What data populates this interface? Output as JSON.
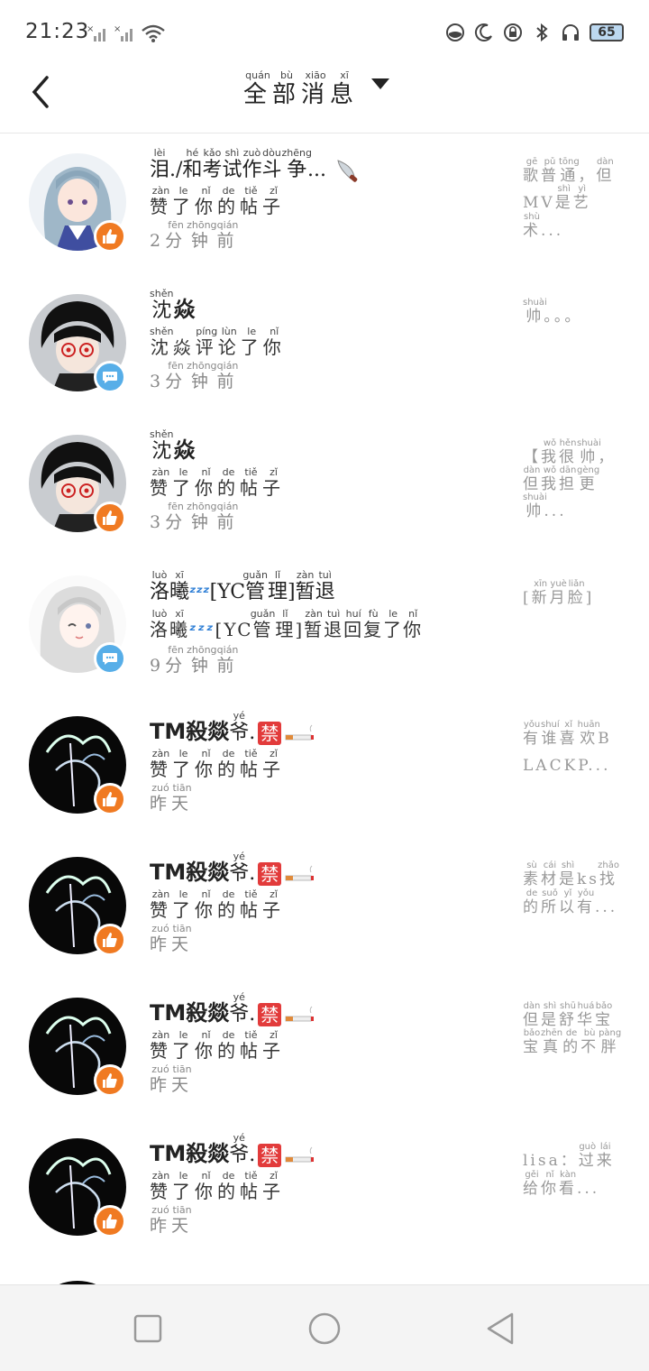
{
  "status_bar": {
    "time": "21:23",
    "battery": "65",
    "icons": [
      "signal-x-icon",
      "signal-x-icon",
      "wifi-icon",
      "data-saver-icon",
      "moon-icon",
      "lock-rotation-icon",
      "bluetooth-icon",
      "headphones-icon",
      "battery-icon"
    ]
  },
  "header": {
    "title_chars": [
      {
        "c": "全",
        "p": "quán"
      },
      {
        "c": "部",
        "p": "bù"
      },
      {
        "c": "消",
        "p": "xiāo"
      },
      {
        "c": "息",
        "p": "xī"
      }
    ]
  },
  "messages": [
    {
      "avatar": "girl-blue-hair",
      "badge": "like",
      "name_prefix": "泪./和考试作斗争...",
      "name_pinyin": "lèi    hé  kǎo  shì  zuò dòu zhēng",
      "action": "赞了你的帖子",
      "action_pinyin": "zàn  le   nǐ   de  tiě  zǐ",
      "time": "2分钟前",
      "time_pinyin": "fēn zhōng qián",
      "preview": "歌普通，但MV是艺术...",
      "preview_pinyin": "gē pǔ tōng dàn shì yì shù"
    },
    {
      "avatar": "boy-glasses",
      "badge": "comment",
      "name_prefix": "沈",
      "name_bold": "焱",
      "name_pinyin": "shěn",
      "action": "沈焱评论了你",
      "action_pinyin": "shěn   píng lùn  le   nǐ",
      "time": "3分钟前",
      "time_pinyin": "fēn zhōng qián",
      "preview": "帅。。。",
      "preview_pinyin": "shuài"
    },
    {
      "avatar": "boy-glasses",
      "badge": "like",
      "name_prefix": "沈",
      "name_bold": "焱",
      "name_pinyin": "shěn",
      "action": "赞了你的帖子",
      "action_pinyin": "zàn  le   nǐ   de  tiě  zǐ",
      "time": "3分钟前",
      "time_pinyin": "fēn zhōng qián",
      "preview": "【我很帅，但我担更帅...",
      "preview_pinyin": "wǒ hěn shuài dàn wǒ dān gèng shuài"
    },
    {
      "avatar": "girl-white-hair",
      "badge": "comment",
      "name_prefix": "洛曦",
      "name_suffix": "[YC管理]暂退",
      "name_pinyin": "luò  xī",
      "action_prefix": "洛曦",
      "action": "[YC管理]暂退回复了你",
      "action_pinyin": "luò  xī",
      "time": "9分钟前",
      "time_pinyin": "fēn zhōng qián",
      "preview": "[新月脸]",
      "preview_pinyin": "xīn yuè liǎn"
    },
    {
      "avatar": "dark-art",
      "badge": "like",
      "name_prefix": "TM殺燚",
      "name_suffix": "爷.",
      "ban": "禁",
      "name_pinyin": "yé",
      "action": "赞了你的帖子",
      "action_pinyin": "zàn  le   nǐ   de  tiě  zǐ",
      "time": "昨天",
      "time_pinyin": "zuó tiān",
      "preview": "有谁喜欢BLACKP...",
      "preview_pinyin": "yǒu shuí xǐ huān"
    },
    {
      "avatar": "dark-art",
      "badge": "like",
      "name_prefix": "TM殺燚",
      "name_suffix": "爷.",
      "ban": "禁",
      "name_pinyin": "yé",
      "action": "赞了你的帖子",
      "action_pinyin": "zàn  le   nǐ   de  tiě  zǐ",
      "time": "昨天",
      "time_pinyin": "zuó tiān",
      "preview": "素材是ks找的所以有...",
      "preview_pinyin": "sù cái shì zhǎo de suǒ yǐ yǒu"
    },
    {
      "avatar": "dark-art",
      "badge": "like",
      "name_prefix": "TM殺燚",
      "name_suffix": "爷.",
      "ban": "禁",
      "name_pinyin": "yé",
      "action": "赞了你的帖子",
      "action_pinyin": "zàn  le   nǐ   de  tiě  zǐ",
      "time": "昨天",
      "time_pinyin": "zuó tiān",
      "preview": "但是舒华宝宝真的不胖",
      "preview_pinyin": "dàn shì shū huá bǎo bǎo zhēn de bù pàng"
    },
    {
      "avatar": "dark-art",
      "badge": "like",
      "name_prefix": "TM殺燚",
      "name_suffix": "爷.",
      "ban": "禁",
      "name_pinyin": "yé",
      "action": "赞了你的帖子",
      "action_pinyin": "zàn  le   nǐ   de  tiě  zǐ",
      "time": "昨天",
      "time_pinyin": "zuó tiān",
      "preview": "lisa：过来给你看...",
      "preview_pinyin": "guò lái gěi nǐ kàn"
    }
  ],
  "nav_bar": {
    "buttons": [
      "recent-apps-button",
      "home-button",
      "back-button"
    ]
  }
}
